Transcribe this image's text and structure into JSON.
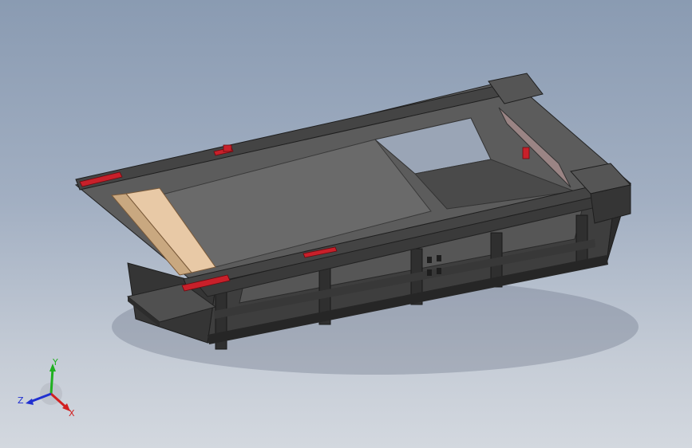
{
  "viewport": {
    "background_top": "#8a9bb2",
    "background_bottom": "#d3d8df"
  },
  "model": {
    "body_color": "#4a4a4a",
    "dark_color": "#2e2e2e",
    "top_color": "#5e5e5e",
    "accent_red": "#c8202a",
    "wood_color": "#e8c9a6"
  },
  "triad": {
    "x_label": "X",
    "y_label": "Y",
    "z_label": "Z",
    "x_color": "#d22020",
    "y_color": "#20b020",
    "z_color": "#2030d0"
  }
}
